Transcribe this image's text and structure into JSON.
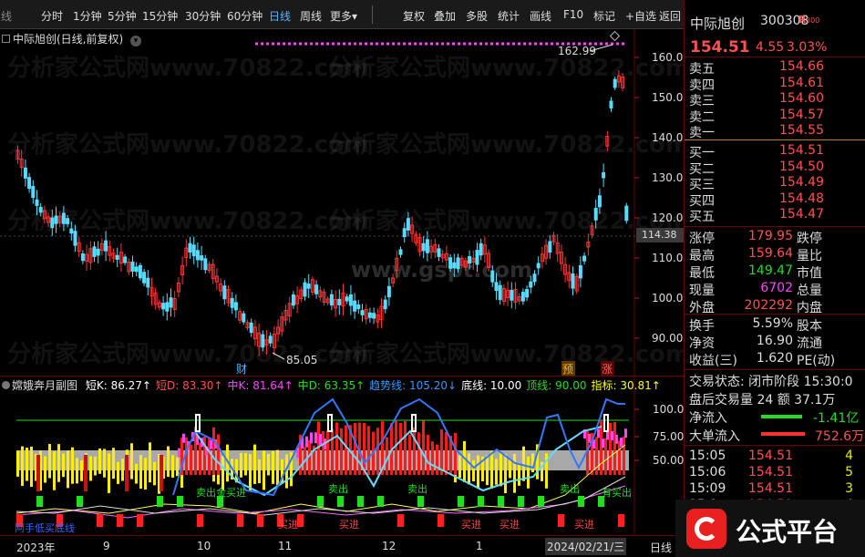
{
  "toolbar": {
    "items": [
      "线",
      "分时",
      "1分钟",
      "5分钟",
      "15分钟",
      "30分钟",
      "60分钟",
      "日线",
      "周线",
      "更多",
      "复权",
      "叠加",
      "多股",
      "统计",
      "画线",
      "F10",
      "标记",
      "+自选",
      "返回"
    ],
    "active": "日线",
    "more_arrow": "▾"
  },
  "chart": {
    "title": "中际旭创(日线,前复权)",
    "high_label": "162.99",
    "low_label": "85.05",
    "current_price_tag": "114.38",
    "price_ticks": [
      "160.0",
      "150.0",
      "140.0",
      "130.0",
      "120.0",
      "110.0",
      "100.0",
      "90.00"
    ],
    "markers": {
      "cai": "财",
      "yu": "预",
      "zhang": "涨"
    },
    "watermarks": [
      "分析家公式网www.70822.com",
      "www.gspt.com"
    ]
  },
  "indicator": {
    "name": "嫦娥奔月副图",
    "params": [
      {
        "label": "短K:",
        "value": "86.27",
        "arrow": "↑",
        "color": "#ffffff"
      },
      {
        "label": "短D:",
        "value": "83.30",
        "arrow": "↑",
        "color": "#ff5050"
      },
      {
        "label": "中K:",
        "value": "81.64",
        "arrow": "↑",
        "color": "#ff44ff"
      },
      {
        "label": "中D:",
        "value": "63.35",
        "arrow": "↑",
        "color": "#22dd22"
      },
      {
        "label": "趋势线:",
        "value": "105.20",
        "arrow": "↓",
        "color": "#3399ff"
      },
      {
        "label": "底线:",
        "value": "10.00",
        "arrow": "",
        "color": "#ffffff"
      },
      {
        "label": "顶线:",
        "value": "90.00",
        "arrow": "",
        "color": "#22dd22"
      },
      {
        "label": "指标:",
        "value": "30.81",
        "arrow": "↑",
        "color": "#ffff00"
      }
    ],
    "ticks": [
      "100.0",
      "75.00",
      "50.00"
    ],
    "signals": {
      "sell": "卖出",
      "buy": "买进",
      "sell_buy": "卖出金买进",
      "you_buy": "有买出"
    },
    "footer": "阿手低买底线"
  },
  "axis": {
    "labels": [
      "2023年",
      "9",
      "10",
      "11",
      "12",
      "1",
      "2024/02/21/三"
    ],
    "cycle": "日线"
  },
  "quote": {
    "name": "中际旭创",
    "code": "300308",
    "flag": "R",
    "flag_sub": "300",
    "price": "154.51",
    "change": "4.55",
    "pct": "3.03%",
    "asks": [
      [
        "卖五",
        "154.66"
      ],
      [
        "卖四",
        "154.61"
      ],
      [
        "卖三",
        "154.60"
      ],
      [
        "卖二",
        "154.57"
      ],
      [
        "卖一",
        "154.55"
      ]
    ],
    "bids": [
      [
        "买一",
        "154.51"
      ],
      [
        "买二",
        "154.50"
      ],
      [
        "买三",
        "154.49"
      ],
      [
        "买四",
        "154.48"
      ],
      [
        "买五",
        "154.47"
      ]
    ],
    "stats": [
      {
        "l1": "涨停",
        "v1": "179.95",
        "c1": "#ff5050",
        "l2": "跌停"
      },
      {
        "l1": "最高",
        "v1": "159.64",
        "c1": "#ff5050",
        "l2": "量比"
      },
      {
        "l1": "最低",
        "v1": "149.47",
        "c1": "#22dd22",
        "l2": "市值"
      },
      {
        "l1": "现量",
        "v1": "6702",
        "c1": "#ff44ff",
        "l2": "总量"
      },
      {
        "l1": "外盘",
        "v1": "202292",
        "c1": "#ff5050",
        "l2": "内盘"
      }
    ],
    "stats2": [
      {
        "l1": "换手",
        "v1": "5.59%",
        "l2": "股本"
      },
      {
        "l1": "净资",
        "v1": "16.90",
        "l2": "流通"
      },
      {
        "l1": "收益(三)",
        "v1": "1.620",
        "l2": "PE(动)"
      }
    ],
    "trade_status": "交易状态: 闭市阶段 15:30:0",
    "after_hours": "盘后交易量 24 额 37.1万",
    "net_inflow_label": "净流入",
    "net_inflow_value": "-1.41亿",
    "big_inflow_label": "大单流入",
    "big_inflow_value": "752.6万",
    "ticks": [
      [
        "15:05",
        "154.51",
        "4"
      ],
      [
        "15:06",
        "154.51",
        "5"
      ],
      [
        "15:09",
        "154.51",
        "3"
      ],
      [
        "15:1",
        "154.51",
        "4"
      ]
    ]
  },
  "badge": {
    "text": "公式平台"
  }
}
